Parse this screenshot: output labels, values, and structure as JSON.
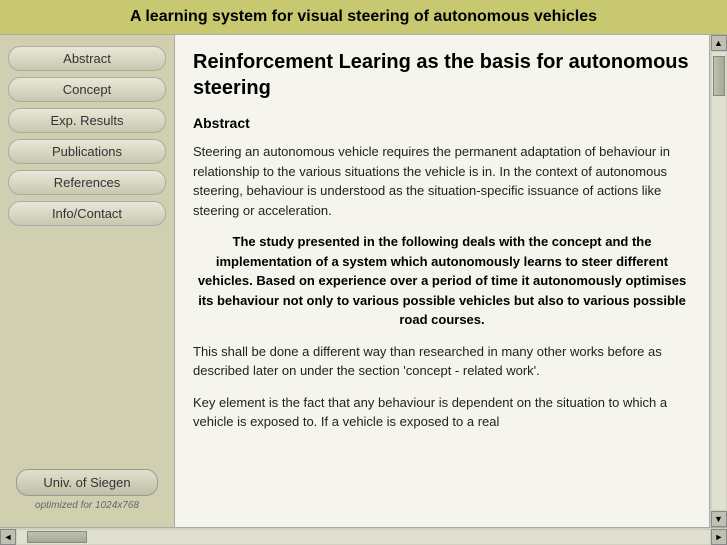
{
  "header": {
    "title": "A learning system for visual steering of autonomous vehicles"
  },
  "sidebar": {
    "nav_items": [
      {
        "id": "abstract",
        "label": "Abstract"
      },
      {
        "id": "concept",
        "label": "Concept"
      },
      {
        "id": "exp-results",
        "label": "Exp. Results"
      },
      {
        "id": "publications",
        "label": "Publications"
      },
      {
        "id": "references",
        "label": "References"
      },
      {
        "id": "info-contact",
        "label": "Info/Contact"
      }
    ],
    "univ_label": "Univ. of Siegen",
    "optimized_text": "optimized for 1024x768"
  },
  "content": {
    "title": "Reinforcement Learing as the basis for autonomous steering",
    "abstract_heading": "Abstract",
    "paragraph1": "Steering an autonomous vehicle requires the permanent adaptation of behaviour in relationship to the various situations the vehicle is in. In the context of autonomous steering, behaviour is understood as the situation-specific issuance of actions like steering or acceleration.",
    "highlight": "The study presented in the following deals with the concept and the implementation of a system which autonomously learns to steer different vehicles. Based on experience over a period of time it autonomously optimises its behaviour not only to various possible vehicles but also to various possible road courses.",
    "paragraph2": "This shall be done a different way than researched in many other works before as described later on under the section 'concept - related work'.",
    "paragraph3": "Key element is the fact that any behaviour is dependent on the situation to which a vehicle is exposed to. If a vehicle is exposed to a real"
  },
  "scrollbar": {
    "up_arrow": "▲",
    "down_arrow": "▼",
    "left_arrow": "◄",
    "right_arrow": "►"
  }
}
